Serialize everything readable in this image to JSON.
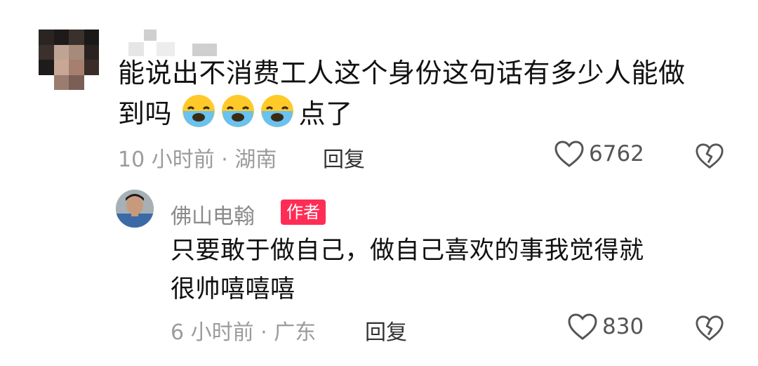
{
  "comment": {
    "text_line1": "能说出不消费工人这个身份这句话有多少人能做",
    "text_line2_start": "到吗",
    "text_line2_end": "点了",
    "emoji_icon": "crying-face-icon",
    "time_location": "10 小时前 · 湖南",
    "reply_label": "回复",
    "like_count": "6762"
  },
  "reply": {
    "username": "佛山电翰",
    "author_badge": "作者",
    "text_line1": "只要敢于做自己，做自己喜欢的事我觉得就",
    "text_line2": "很帅嘻嘻嘻",
    "time_location": "6 小时前 · 广东",
    "reply_label": "回复",
    "like_count": "830"
  },
  "colors": {
    "badge": "#ff2c55",
    "meta": "#9b9b9b"
  }
}
